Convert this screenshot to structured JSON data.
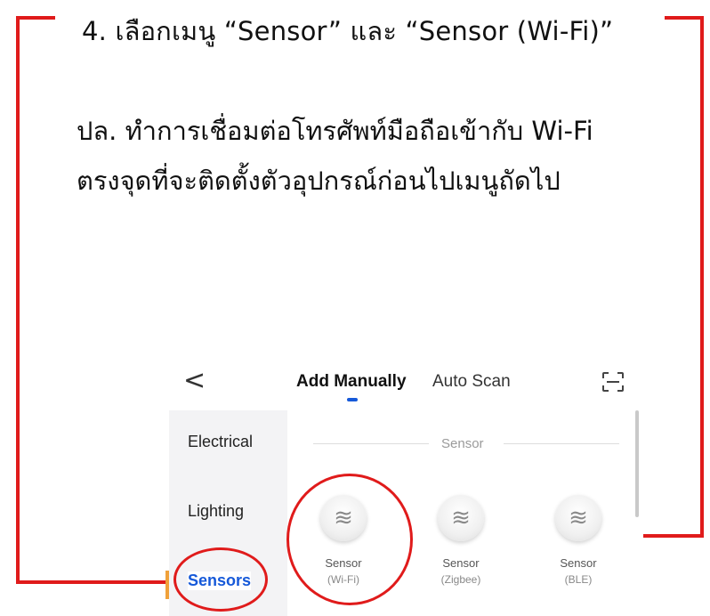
{
  "instruction": {
    "title": "4. เลือกเมนู “Sensor” และ “Sensor (Wi-Fi)”",
    "note_line1": "ปล. ทำการเชื่อมต่อโทรศัพท์มือถือเข้ากับ Wi-Fi",
    "note_line2": "ตรงจุดที่จะติดตั้งตัวอุปกรณ์ก่อนไปเมนูถัดไป"
  },
  "app": {
    "back_glyph": "<",
    "tabs": [
      "Add Manually",
      "Auto Scan"
    ],
    "sidebar": [
      "Electrical",
      "Lighting",
      "Sensors"
    ],
    "section_title": "Sensor",
    "devices": [
      {
        "name": "Sensor",
        "sub": "(Wi-Fi)",
        "icon": "≋"
      },
      {
        "name": "Sensor",
        "sub": "(Zigbee)",
        "icon": "≋"
      },
      {
        "name": "Sensor",
        "sub": "(BLE)",
        "icon": "≋"
      }
    ]
  },
  "colors": {
    "annotation_red": "#e01b1b",
    "tab_indicator_blue": "#1659d9",
    "active_sidebar_accent": "#f0a13a"
  },
  "icons": [
    "back-chevron-icon",
    "scan-frame-icon",
    "sensor-wave-icon"
  ]
}
